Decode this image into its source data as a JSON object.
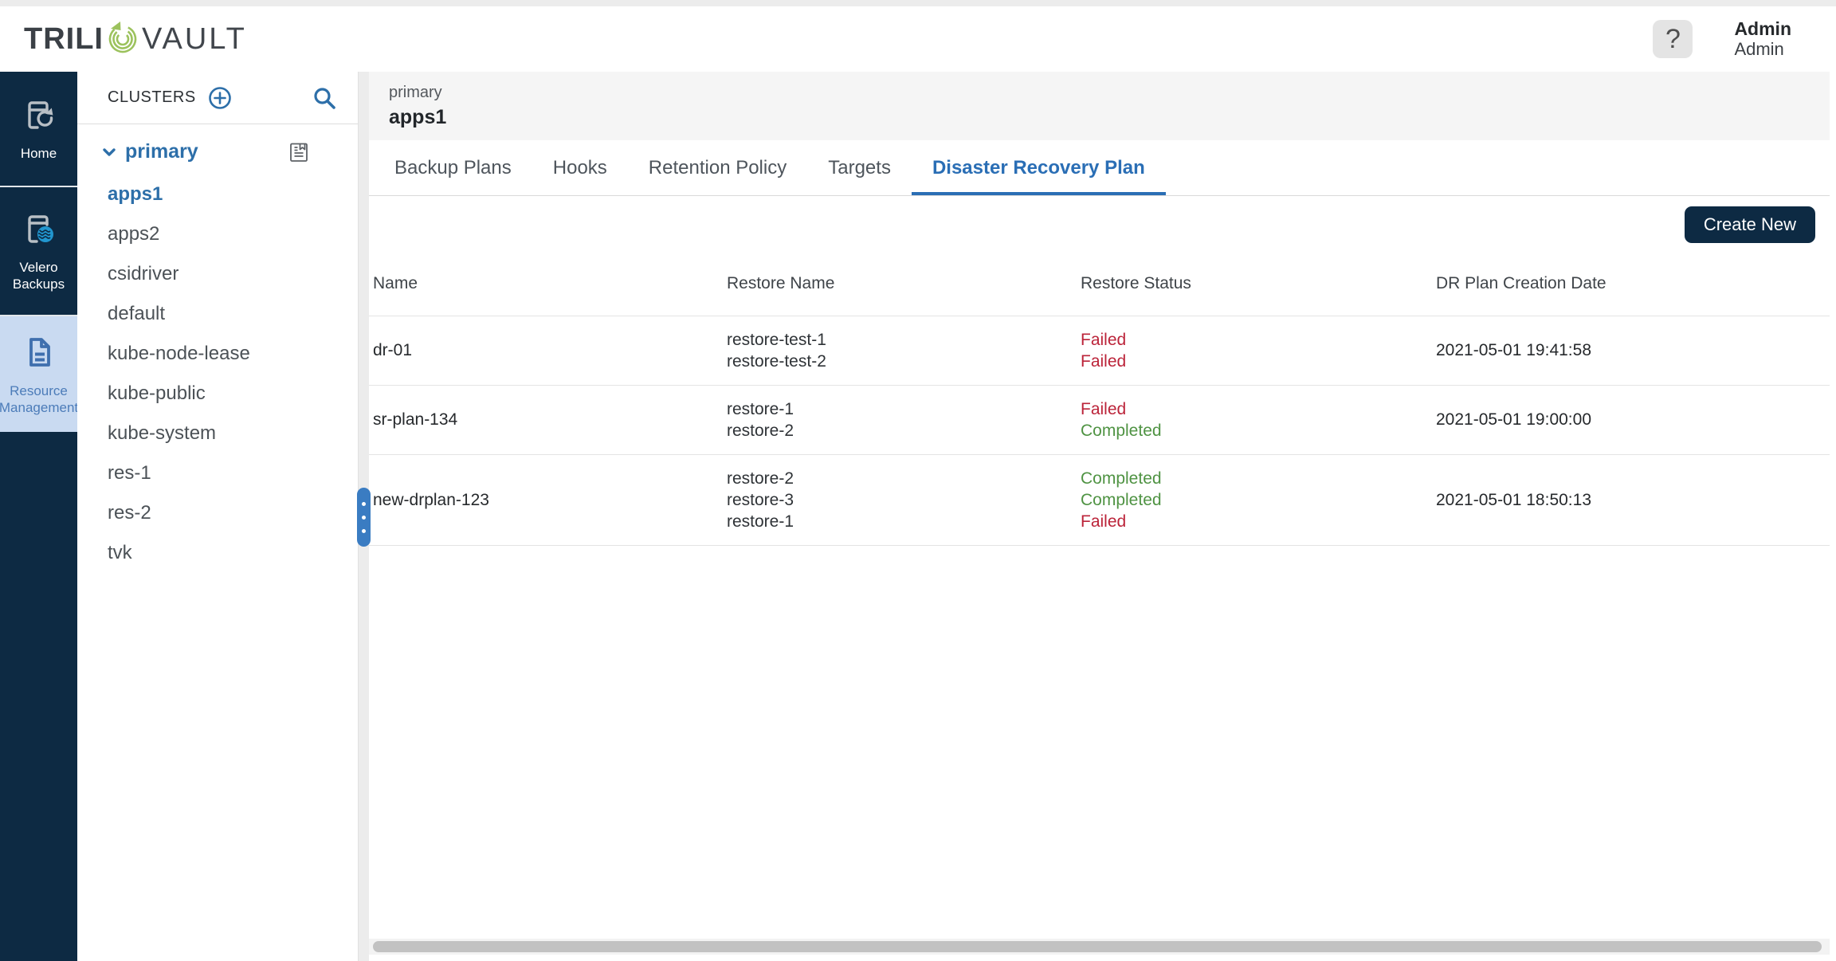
{
  "topbar": {
    "logo": {
      "part1": "TRILI",
      "part2": "VAULT"
    },
    "help_label": "?",
    "user": {
      "name": "Admin",
      "role": "Admin"
    }
  },
  "rail": {
    "items": [
      {
        "label": "Home",
        "active": false
      },
      {
        "label": "Velero Backups",
        "active": false
      },
      {
        "label": "Resource Management",
        "active": true
      }
    ]
  },
  "clusters_panel": {
    "title": "CLUSTERS",
    "cluster": {
      "name": "primary",
      "expanded": true
    },
    "namespaces": [
      {
        "name": "apps1",
        "selected": true
      },
      {
        "name": "apps2",
        "selected": false
      },
      {
        "name": "csidriver",
        "selected": false
      },
      {
        "name": "default",
        "selected": false
      },
      {
        "name": "kube-node-lease",
        "selected": false
      },
      {
        "name": "kube-public",
        "selected": false
      },
      {
        "name": "kube-system",
        "selected": false
      },
      {
        "name": "res-1",
        "selected": false
      },
      {
        "name": "res-2",
        "selected": false
      },
      {
        "name": "tvk",
        "selected": false
      }
    ]
  },
  "main": {
    "breadcrumb": {
      "cluster": "primary",
      "namespace": "apps1"
    },
    "tabs": [
      {
        "label": "Backup Plans",
        "active": false
      },
      {
        "label": "Hooks",
        "active": false
      },
      {
        "label": "Retention Policy",
        "active": false
      },
      {
        "label": "Targets",
        "active": false
      },
      {
        "label": "Disaster Recovery Plan",
        "active": true
      }
    ],
    "create_button": "Create New",
    "table": {
      "columns": [
        "Name",
        "Restore Name",
        "Restore Status",
        "DR Plan Creation Date"
      ],
      "rows": [
        {
          "name": "dr-01",
          "restores": [
            {
              "name": "restore-test-1",
              "status": "Failed"
            },
            {
              "name": "restore-test-2",
              "status": "Failed"
            }
          ],
          "created": "2021-05-01 19:41:58"
        },
        {
          "name": "sr-plan-134",
          "restores": [
            {
              "name": "restore-1",
              "status": "Failed"
            },
            {
              "name": "restore-2",
              "status": "Completed"
            }
          ],
          "created": "2021-05-01 19:00:00"
        },
        {
          "name": "new-drplan-123",
          "restores": [
            {
              "name": "restore-2",
              "status": "Completed"
            },
            {
              "name": "restore-3",
              "status": "Completed"
            },
            {
              "name": "restore-1",
              "status": "Failed"
            }
          ],
          "created": "2021-05-01 18:50:13"
        }
      ]
    }
  },
  "colors": {
    "navy": "#0d2a43",
    "accent_blue": "#2d6fa9",
    "tab_active": "#2a6eb5",
    "rail_active_bg": "#c9daf1",
    "rail_active_text": "#4c7cb9",
    "failed": "#bb2339",
    "completed": "#4f9343",
    "logo_green": "#9cc25d"
  }
}
